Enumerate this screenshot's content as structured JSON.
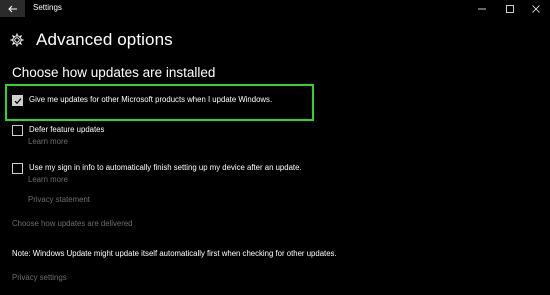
{
  "window": {
    "title": "Settings",
    "back_icon": "arrow-left-icon",
    "controls": [
      "minimize-icon",
      "maximize-icon",
      "close-icon"
    ]
  },
  "header": {
    "icon": "gear-icon",
    "title": "Advanced options"
  },
  "section": {
    "title": "Choose how updates are installed"
  },
  "options": [
    {
      "label": "Give me updates for other Microsoft products when I update Windows.",
      "checked": true,
      "learn_more": ""
    },
    {
      "label": "Defer feature updates",
      "checked": false,
      "learn_more": "Learn more"
    },
    {
      "label": "Use my sign in info to automatically finish setting up my device after an update.",
      "checked": false,
      "learn_more": "Learn more"
    }
  ],
  "links": {
    "privacy_statement": "Privacy statement",
    "delivery": "Choose how updates are delivered",
    "privacy_settings": "Privacy settings"
  },
  "note": "Note: Windows Update might update itself automatically first when checking for other updates.",
  "colors": {
    "background": "#000000",
    "highlight_border": "#2bd62b",
    "dim_link": "#6e6e6e"
  }
}
